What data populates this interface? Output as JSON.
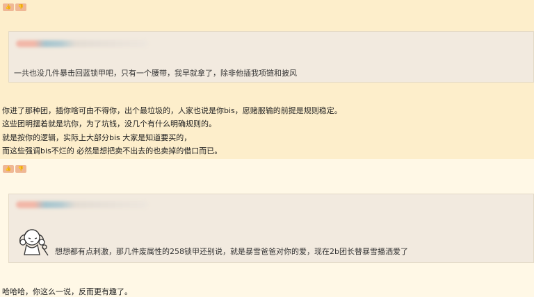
{
  "vote": {
    "up_icon": "👍",
    "down_icon": "👎"
  },
  "posts": [
    {
      "quote": {
        "author_name": "",
        "text": "一共也没几件暴击回蓝锁甲吧，只有一个腰带，我早就拿了，除非他插我项链和披风"
      },
      "body": [
        "你进了那种团，插你啥可由不得你，出个最垃圾的，人家也说是你bis，愿赌服输的前提是规则稳定。",
        "这些团明摆着就是坑你，为了坑钱，没几个有什么明确规则的。",
        "就是按你的逻辑，实际上大部分bis 大家是知道要买的，",
        "而这些强调bis不烂的 必然是想把卖不出去的也卖掉的借口而已。"
      ]
    },
    {
      "quote": {
        "author_name": "",
        "text": "想想都有点刺激，那几件废属性的258锁甲还别说，就是暴雪爸爸对你的爱，现在2b团长替暴雪播洒爱了"
      },
      "body": [
        "哈哈哈，你这么一说，反而更有趣了。"
      ]
    }
  ],
  "colors": {
    "band_primary": "#fdeecb",
    "band_secondary": "#fff8e6",
    "quote_bg": "#f2eadf",
    "vote_button": "#efb795"
  }
}
